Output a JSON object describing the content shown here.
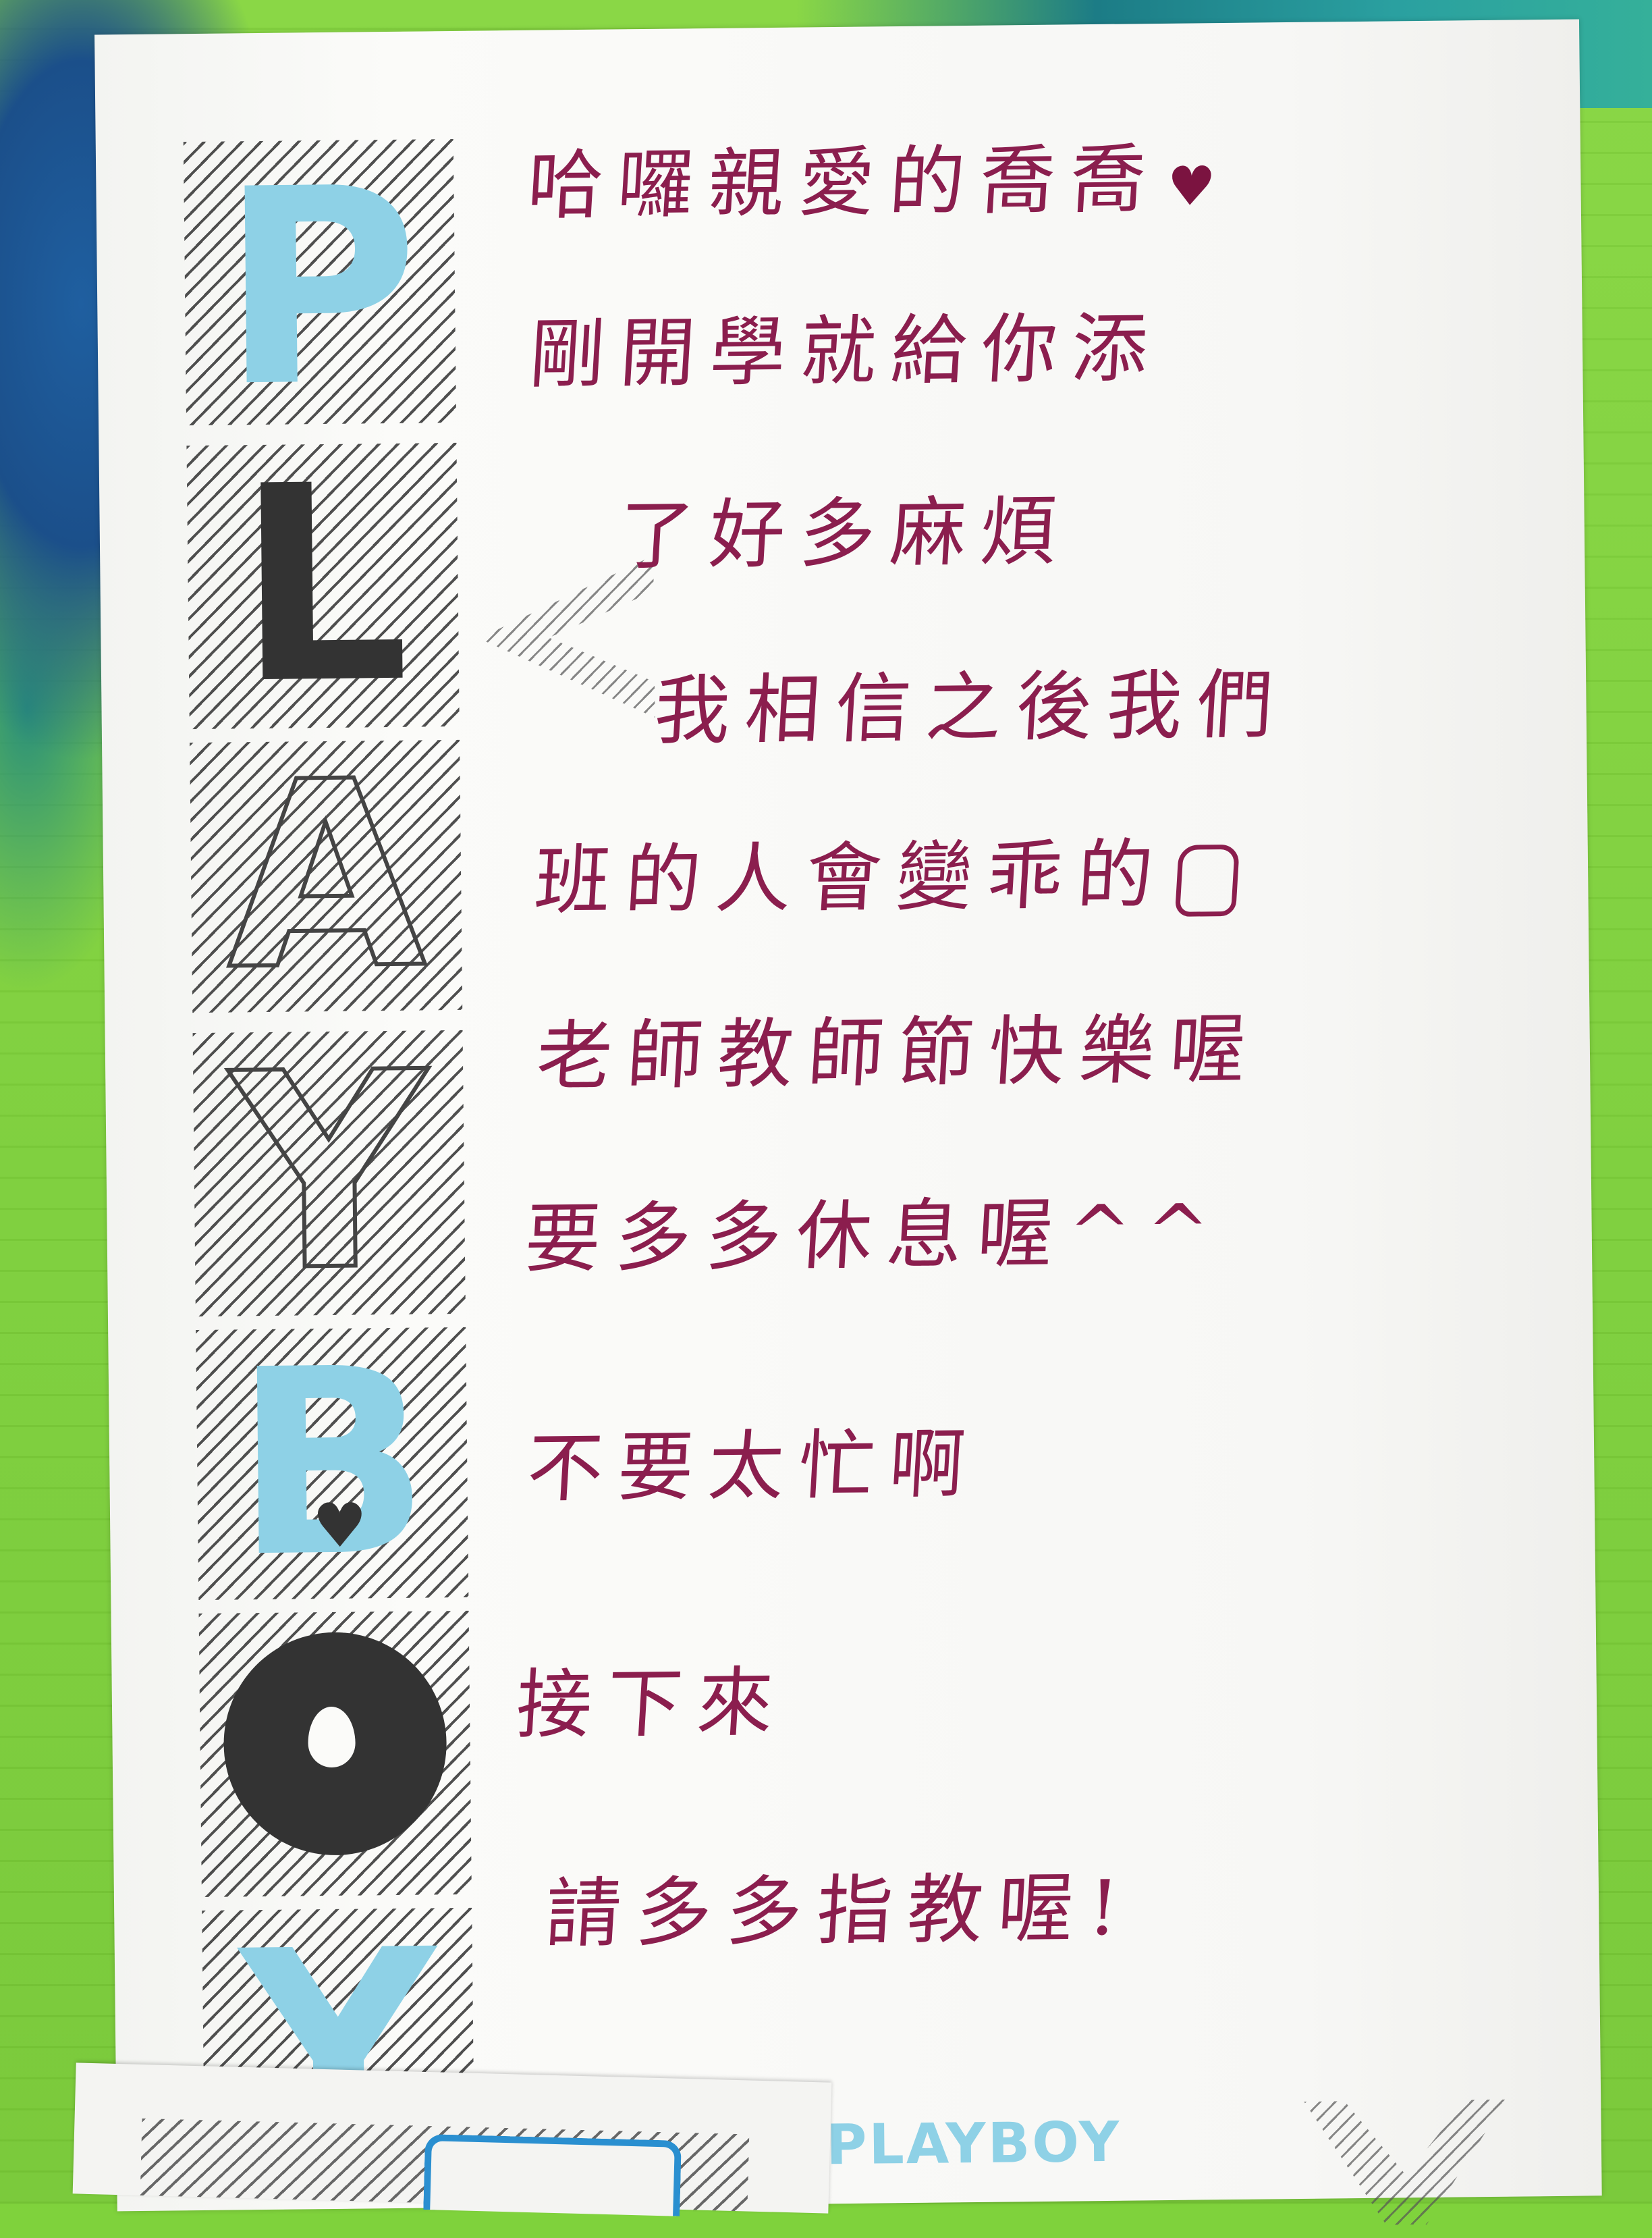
{
  "note": {
    "lines": [
      "哈囉親愛的喬喬",
      "剛開學就給你添",
      "了好多麻煩",
      "我相信之後我們",
      "班的人會變乖的",
      "老師教師節快樂喔",
      "要多多休息喔^^",
      "不要太忙啊",
      "接下來",
      "請多多指教喔!"
    ],
    "ink_color": "#8b1e4e"
  },
  "paper": {
    "side_letters": [
      "P",
      "L",
      "A",
      "Y",
      "B",
      "O",
      "Y"
    ],
    "brand": "PLAYBOY",
    "accent_color": "#8ed1e6",
    "dark_color": "#333333"
  },
  "icons": [
    "heart-icon",
    "thumbs-up-icon",
    "heart-icon",
    "drop-icon"
  ]
}
